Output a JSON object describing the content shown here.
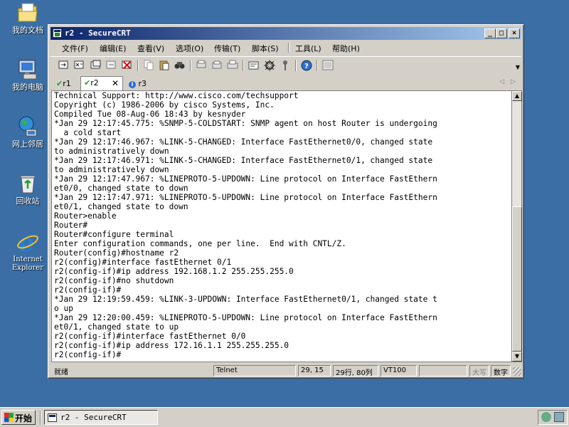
{
  "desktop": {
    "icons": [
      {
        "label": "我的文档"
      },
      {
        "label": "我的电脑"
      },
      {
        "label": "网上邻居"
      },
      {
        "label": "回收站"
      },
      {
        "label": "Internet Explorer"
      }
    ]
  },
  "window": {
    "title": "r2 - SecureCRT",
    "controls": {
      "minimize": "_",
      "maximize": "□",
      "close": "×"
    }
  },
  "menu": {
    "items": [
      "文件(F)",
      "编辑(E)",
      "查看(V)",
      "选项(O)",
      "传输(T)",
      "脚本(S)",
      "工具(L)",
      "帮助(H)"
    ]
  },
  "tabs": [
    {
      "label": "r1",
      "status": "connected"
    },
    {
      "label": "r2",
      "status": "connected",
      "active": true
    },
    {
      "label": "r3",
      "status": "info"
    }
  ],
  "tab_close": "✕",
  "terminal": {
    "lines": [
      "Technical Support: http://www.cisco.com/techsupport",
      "Copyright (c) 1986-2006 by cisco Systems, Inc.",
      "Compiled Tue 08-Aug-06 18:43 by kesnyder",
      "*Jan 29 12:17:45.775: %SNMP-5-COLDSTART: SNMP agent on host Router is undergoing",
      "  a cold start",
      "*Jan 29 12:17:46.967: %LINK-5-CHANGED: Interface FastEthernet0/0, changed state",
      "to administratively down",
      "*Jan 29 12:17:46.971: %LINK-5-CHANGED: Interface FastEthernet0/1, changed state",
      "to administratively down",
      "*Jan 29 12:17:47.967: %LINEPROTO-5-UPDOWN: Line protocol on Interface FastEthern",
      "et0/0, changed state to down",
      "*Jan 29 12:17:47.971: %LINEPROTO-5-UPDOWN: Line protocol on Interface FastEthern",
      "et0/1, changed state to down",
      "Router>enable",
      "Router#",
      "Router#configure terminal",
      "Enter configuration commands, one per line.  End with CNTL/Z.",
      "Router(config)#hostname r2",
      "r2(config)#interface fastEthernet 0/1",
      "r2(config-if)#ip address 192.168.1.2 255.255.255.0",
      "r2(config-if)#no shutdown",
      "r2(config-if)#",
      "*Jan 29 12:19:59.459: %LINK-3-UPDOWN: Interface FastEthernet0/1, changed state t",
      "o up",
      "*Jan 29 12:20:00.459: %LINEPROTO-5-UPDOWN: Line protocol on Interface FastEthern",
      "et0/1, changed state to up",
      "r2(config-if)#interface fastEthernet 0/0",
      "r2(config-if)#ip address 172.16.1.1 255.255.255.0",
      "r2(config-if)#"
    ]
  },
  "status": {
    "ready": "就绪",
    "protocol": "Telnet",
    "cursor": "29, 15",
    "size": "29行, 80列",
    "emulation": "VT100",
    "caps": "大写",
    "num": "数字"
  },
  "taskbar": {
    "start": "开始",
    "task": "r2 - SecureCRT"
  }
}
